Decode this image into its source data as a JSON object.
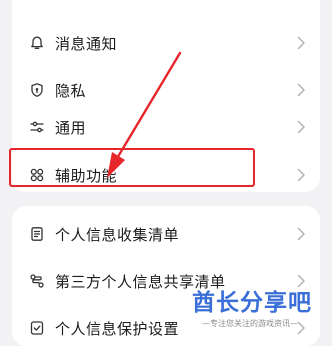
{
  "settings_groups": [
    {
      "items": [
        {
          "label": "消息通知",
          "icon": "bell-icon"
        },
        {
          "label": "隐私",
          "icon": "shield-icon"
        },
        {
          "label": "通用",
          "icon": "sliders-icon"
        },
        {
          "label": "辅助功能",
          "icon": "grid-icon"
        }
      ]
    },
    {
      "items": [
        {
          "label": "个人信息收集清单",
          "icon": "document-icon"
        },
        {
          "label": "第三方个人信息共享清单",
          "icon": "share-icon"
        },
        {
          "label": "个人信息保护设置",
          "icon": "shield-check-icon"
        }
      ]
    }
  ],
  "annotation": {
    "highlighted_item": "辅助功能",
    "color": "#e5262a"
  },
  "watermark": {
    "logo": "酋长分享吧",
    "slogan": "—专注您关注的游戏资讯—"
  }
}
